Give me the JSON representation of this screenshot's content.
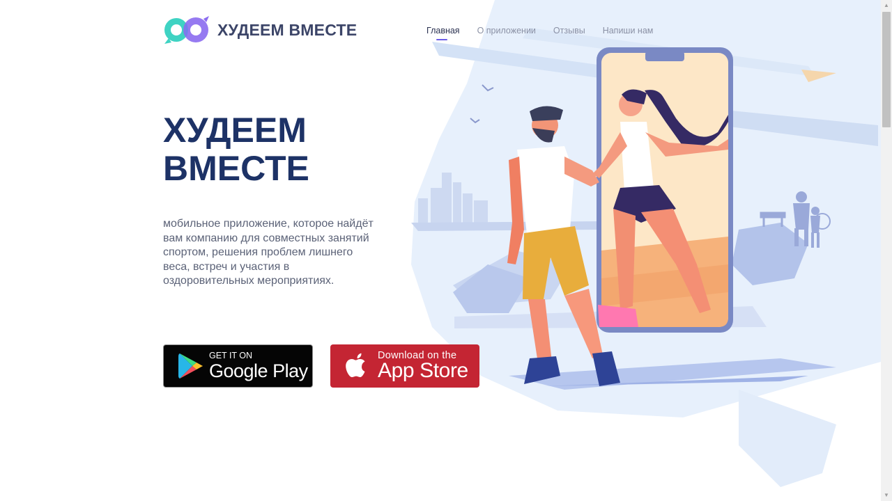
{
  "brand": {
    "name": "ХУДЕЕМ ВМЕСТЕ"
  },
  "nav": {
    "items": [
      {
        "label": "Главная",
        "active": true
      },
      {
        "label": "О приложении",
        "active": false
      },
      {
        "label": "Отзывы",
        "active": false
      },
      {
        "label": "Напиши нам",
        "active": false
      }
    ]
  },
  "hero": {
    "title_line1": "ХУДЕЕМ",
    "title_line2": "ВМЕСТЕ",
    "description": "мобильное приложение, которое найдёт вам компанию для совместных занятий спортом, решения проблем лишнего веса, встреч и участия в оздоровительных мероприятиях."
  },
  "stores": {
    "google": {
      "small": "GET IT ON",
      "big": "Google Play",
      "icon": "google-play-icon",
      "color": "#000000"
    },
    "apple": {
      "small": "Download on the",
      "big": "App Store",
      "icon": "apple-icon",
      "color": "#c42533"
    }
  },
  "colors": {
    "title": "#1d3266",
    "accent": "#6b5ce7",
    "logo_teal": "#3fd3c3",
    "logo_violet": "#8b6cf0"
  }
}
